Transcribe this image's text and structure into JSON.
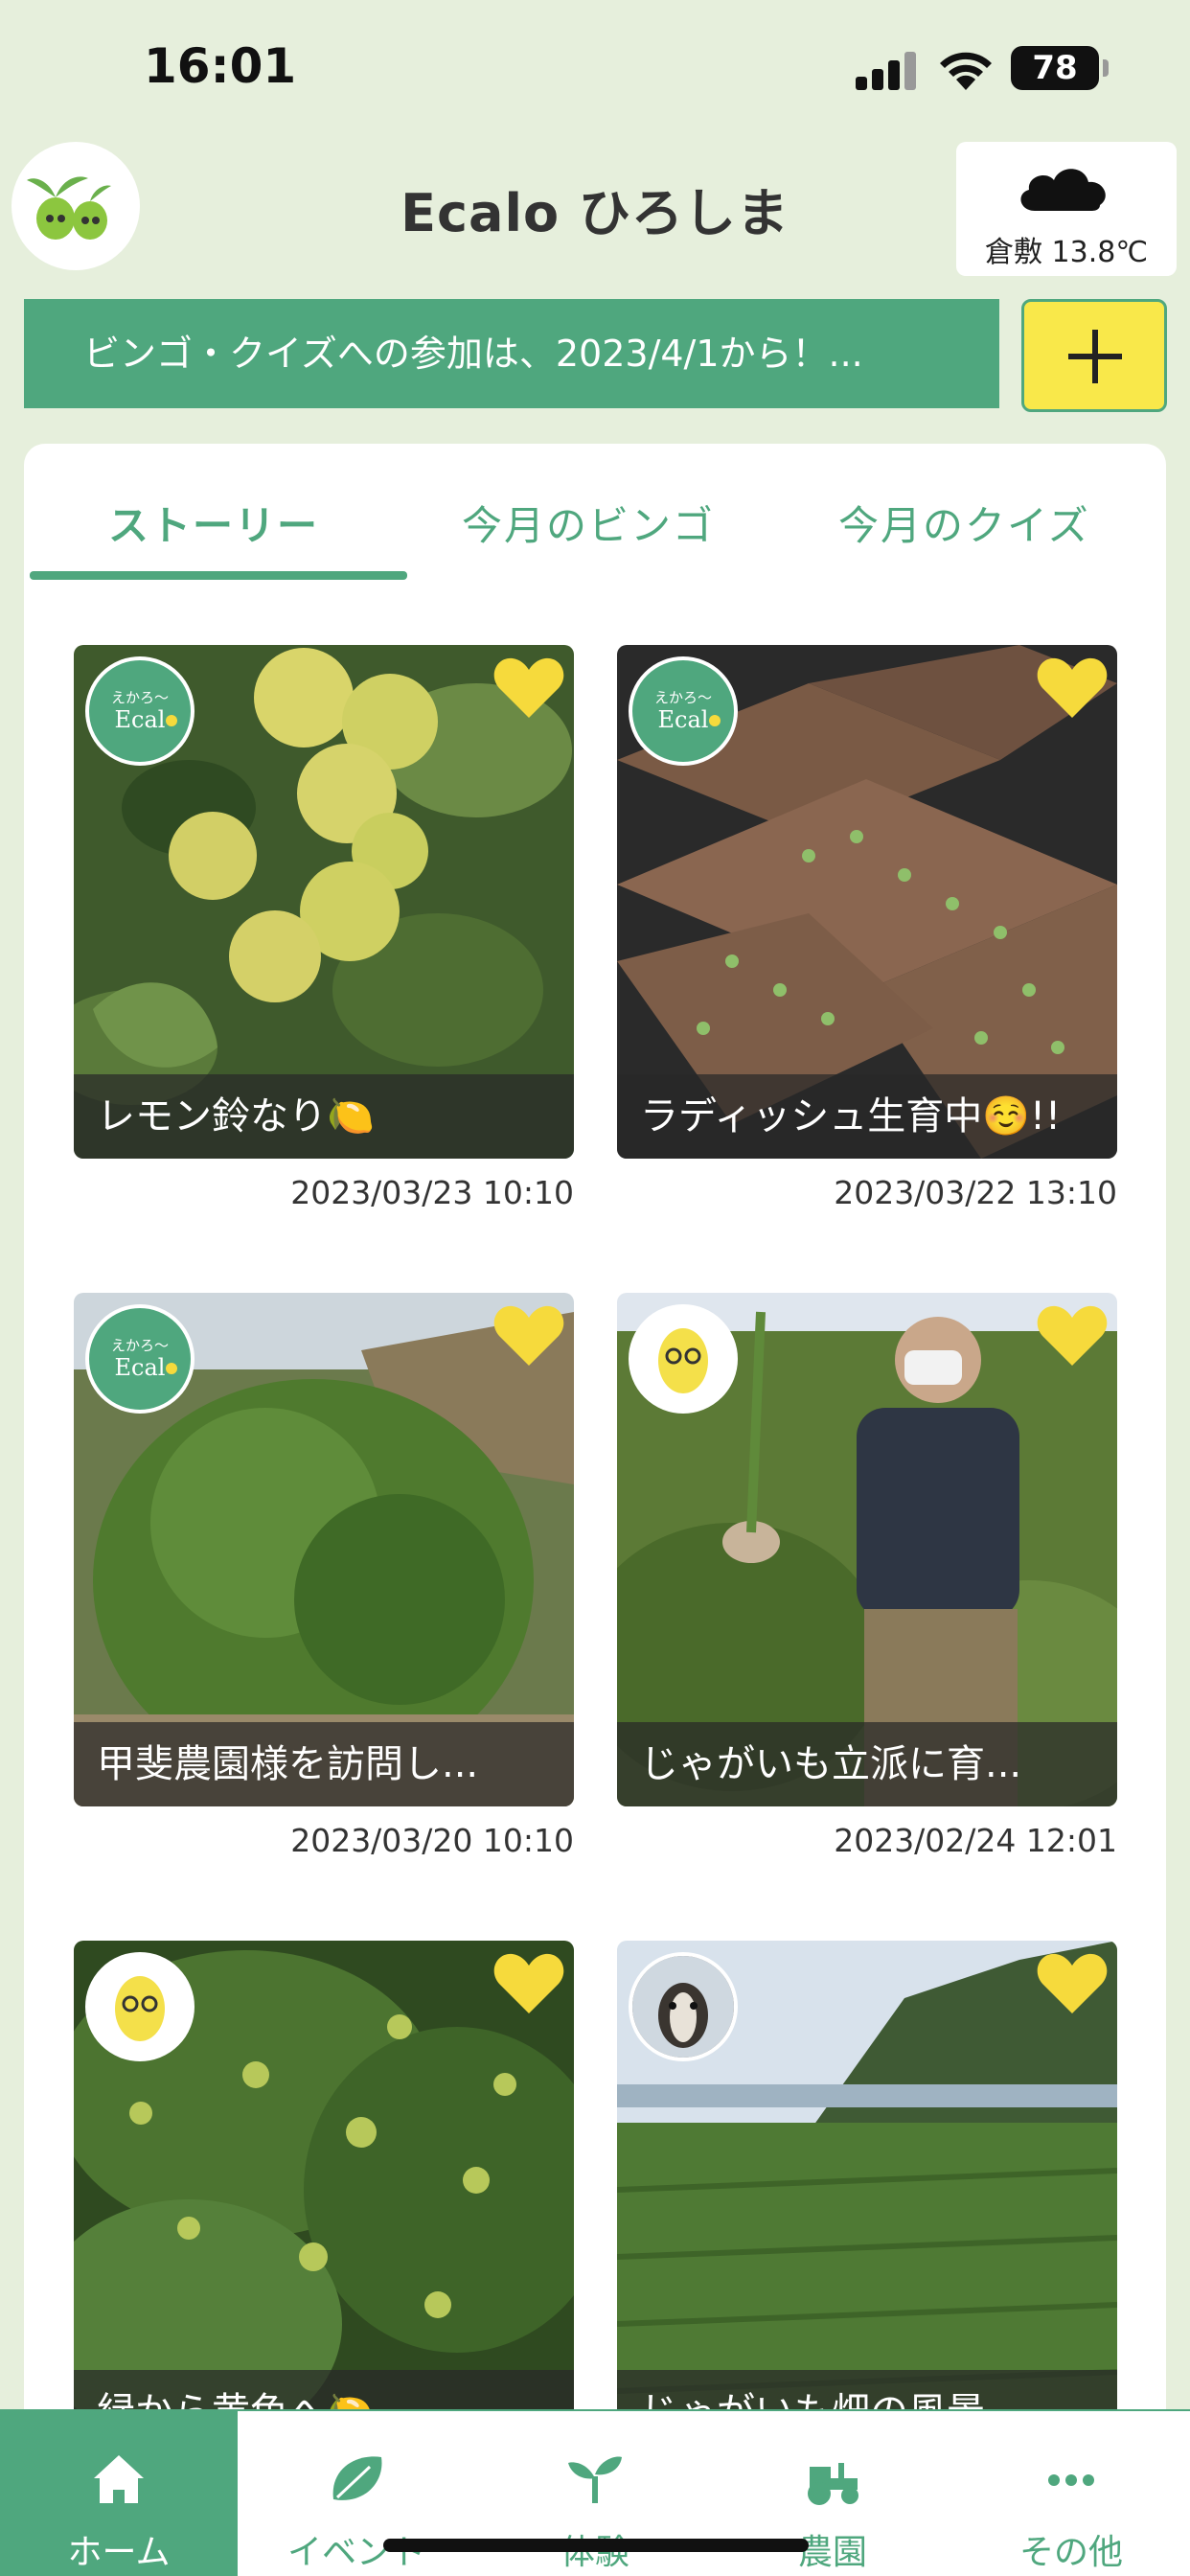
{
  "status_bar": {
    "time": "16:01",
    "battery": "78"
  },
  "header": {
    "title": "Ecalo ひろしま",
    "weather": "倉敷 13.8℃"
  },
  "banner": {
    "text": "ビンゴ・クイズへの参加は、2023/4/1から！..."
  },
  "tabs": [
    {
      "label": "ストーリー",
      "active": true
    },
    {
      "label": "今月のビンゴ",
      "active": false
    },
    {
      "label": "今月のクイズ",
      "active": false
    }
  ],
  "stories": [
    {
      "caption": "レモン鈴なり🍋",
      "date": "2023/03/23 10:10",
      "avatar": "ecalo-logo"
    },
    {
      "caption": "ラディッシュ生育中☺️!!",
      "date": "2023/03/22 13:10",
      "avatar": "ecalo-logo"
    },
    {
      "caption": "甲斐農園様を訪問し...",
      "date": "2023/03/20 10:10",
      "avatar": "ecalo-logo"
    },
    {
      "caption": "じゃがいも立派に育...",
      "date": "2023/02/24 12:01",
      "avatar": "lemon-character"
    },
    {
      "caption": "緑から黄色へ🍋",
      "date": "",
      "avatar": "lemon-character"
    },
    {
      "caption": "じゃがいも畑の風景",
      "date": "",
      "avatar": "goat-photo"
    }
  ],
  "bottom_nav": [
    {
      "label": "ホーム",
      "icon": "home-icon",
      "active": true
    },
    {
      "label": "イベント",
      "icon": "leaf-icon",
      "active": false
    },
    {
      "label": "体験",
      "icon": "sprout-icon",
      "active": false
    },
    {
      "label": "農園",
      "icon": "tractor-icon",
      "active": false
    },
    {
      "label": "その他",
      "icon": "more-icon",
      "active": false
    }
  ],
  "colors": {
    "primary": "#4fa77e",
    "accent": "#f9e84a",
    "background": "#e6efdc",
    "heart": "#f6da3c"
  }
}
